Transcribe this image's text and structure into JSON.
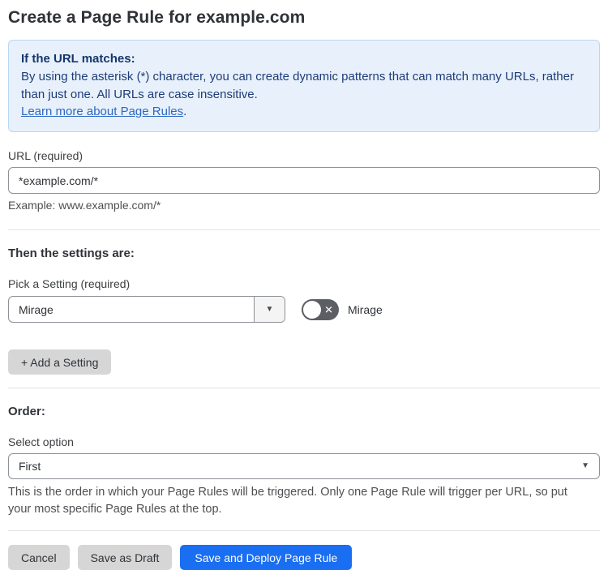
{
  "page": {
    "title": "Create a Page Rule for example.com"
  },
  "info_box": {
    "heading": "If the URL matches:",
    "body": "By using the asterisk (*) character, you can create dynamic patterns that can match many URLs, rather than just one. All URLs are case insensitive.",
    "link_text": "Learn more about Page Rules",
    "link_suffix": "."
  },
  "url_field": {
    "label": "URL (required)",
    "value": "*example.com/*",
    "helper": "Example: www.example.com/*"
  },
  "settings_section": {
    "heading": "Then the settings are:",
    "picker_label": "Pick a Setting (required)",
    "picker_value": "Mirage",
    "toggle_label": "Mirage",
    "toggle_state": "off",
    "toggle_glyph": "✕",
    "arrow_glyph": "▼",
    "add_setting_button": "+ Add a Setting"
  },
  "order_section": {
    "heading": "Order:",
    "select_label": "Select option",
    "select_value": "First",
    "arrow_glyph": "▼",
    "helper": "This is the order in which your Page Rules will be triggered. Only one Page Rule will trigger per URL, so put your most specific Page Rules at the top."
  },
  "footer": {
    "cancel_label": "Cancel",
    "save_draft_label": "Save as Draft",
    "save_deploy_label": "Save and Deploy Page Rule"
  },
  "colors": {
    "accent_blue": "#1a6ef2",
    "info_background": "#e8f1fb",
    "info_border": "#b9d6f2",
    "info_text": "#1d3c78",
    "link_blue": "#2d68c4",
    "toggle_off_gray": "#5b5e63",
    "button_gray": "#d6d6d6"
  }
}
